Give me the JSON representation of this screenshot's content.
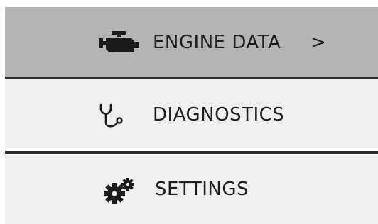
{
  "menu": {
    "items": [
      {
        "label": "ENGINE DATA",
        "icon": "engine-icon",
        "chevron": ">",
        "selected": true
      },
      {
        "label": "DIAGNOSTICS",
        "icon": "stethoscope-icon"
      },
      {
        "label": "SETTINGS",
        "icon": "gears-icon"
      }
    ]
  },
  "colors": {
    "selected_bg": "#b4b4b4",
    "item_bg": "#efefef",
    "divider": "#2e2e2e",
    "text": "#1e1e1e"
  }
}
